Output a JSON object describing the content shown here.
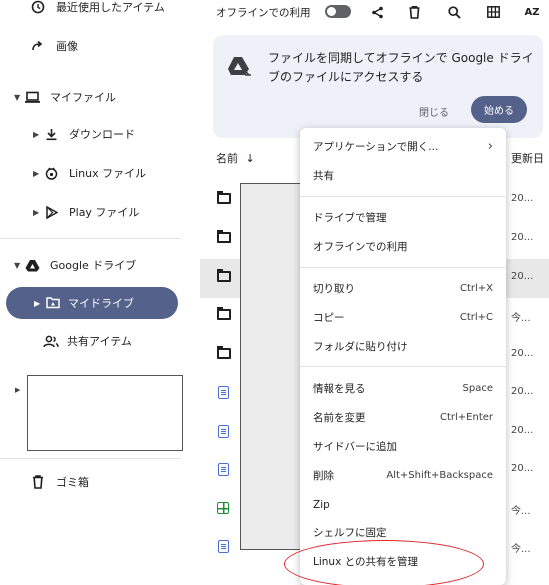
{
  "sidebar": {
    "recent": "最近使用したアイテム",
    "images": "画像",
    "my_files": "マイファイル",
    "downloads": "ダウンロード",
    "linux_files": "Linux ファイル",
    "play_files": "Play ファイル",
    "google_drive": "Google ドライブ",
    "my_drive": "マイドライブ",
    "shared": "共有アイテム",
    "trash": "ゴミ箱"
  },
  "toolbar": {
    "offline_label": "オフラインでの利用",
    "sort_label": "AZ"
  },
  "banner": {
    "message": "ファイルを同期してオフラインで Google ドライブのファイルにアクセスする",
    "dismiss": "閉じる",
    "start": "始める"
  },
  "columns": {
    "name": "名前",
    "modified": "更新日"
  },
  "rows": [
    {
      "type": "folder",
      "date": "20..."
    },
    {
      "type": "folder",
      "date": "20..."
    },
    {
      "type": "folder",
      "date": "20..."
    },
    {
      "type": "folder",
      "date": "今..."
    },
    {
      "type": "folder",
      "date": "20..."
    },
    {
      "type": "doc",
      "date": "20..."
    },
    {
      "type": "doc",
      "date": "20..."
    },
    {
      "type": "doc",
      "date": "20..."
    },
    {
      "type": "sheet",
      "date": "今..."
    },
    {
      "type": "doc",
      "date": "今..."
    }
  ],
  "menu": {
    "open_with": "アプリケーションで開く...",
    "share": "共有",
    "manage_drive": "ドライブで管理",
    "offline": "オフラインでの利用",
    "cut": "切り取り",
    "cut_sc": "Ctrl+X",
    "copy": "コピー",
    "copy_sc": "Ctrl+C",
    "paste": "フォルダに貼り付け",
    "info": "情報を見る",
    "info_sc": "Space",
    "rename": "名前を変更",
    "rename_sc": "Ctrl+Enter",
    "add_sidebar": "サイドバーに追加",
    "delete": "削除",
    "delete_sc": "Alt+Shift+Backspace",
    "zip": "Zip",
    "pin_shelf": "シェルフに固定",
    "linux_share": "Linux との共有を管理"
  },
  "colors": {
    "accent": "#54618a",
    "highlight_ellipse": "#e0242c"
  }
}
